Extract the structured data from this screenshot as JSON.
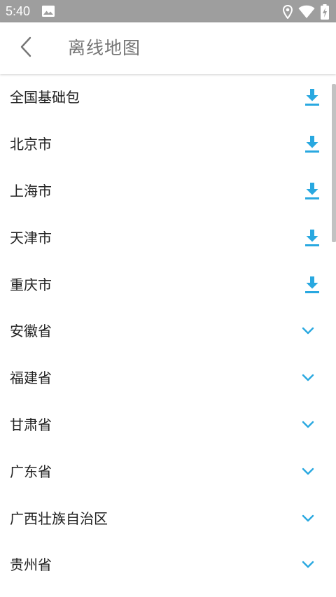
{
  "status_bar": {
    "time": "5:40",
    "icons": [
      "image-icon",
      "location-icon",
      "wifi-icon",
      "battery-charging-icon"
    ],
    "background": "#9e9e9e"
  },
  "app_bar": {
    "back_icon": "chevron-left-icon",
    "title": "离线地图"
  },
  "colors": {
    "accent": "#29a8e0",
    "text": "#212121",
    "title": "#757575"
  },
  "list": {
    "items": [
      {
        "label": "全国基础包",
        "action": "download-icon"
      },
      {
        "label": "北京市",
        "action": "download-icon"
      },
      {
        "label": "上海市",
        "action": "download-icon"
      },
      {
        "label": "天津市",
        "action": "download-icon"
      },
      {
        "label": "重庆市",
        "action": "download-icon"
      },
      {
        "label": "安徽省",
        "action": "chevron-down-icon"
      },
      {
        "label": "福建省",
        "action": "chevron-down-icon"
      },
      {
        "label": "甘肃省",
        "action": "chevron-down-icon"
      },
      {
        "label": "广东省",
        "action": "chevron-down-icon"
      },
      {
        "label": "广西壮族自治区",
        "action": "chevron-down-icon"
      },
      {
        "label": "贵州省",
        "action": "chevron-down-icon"
      }
    ]
  }
}
